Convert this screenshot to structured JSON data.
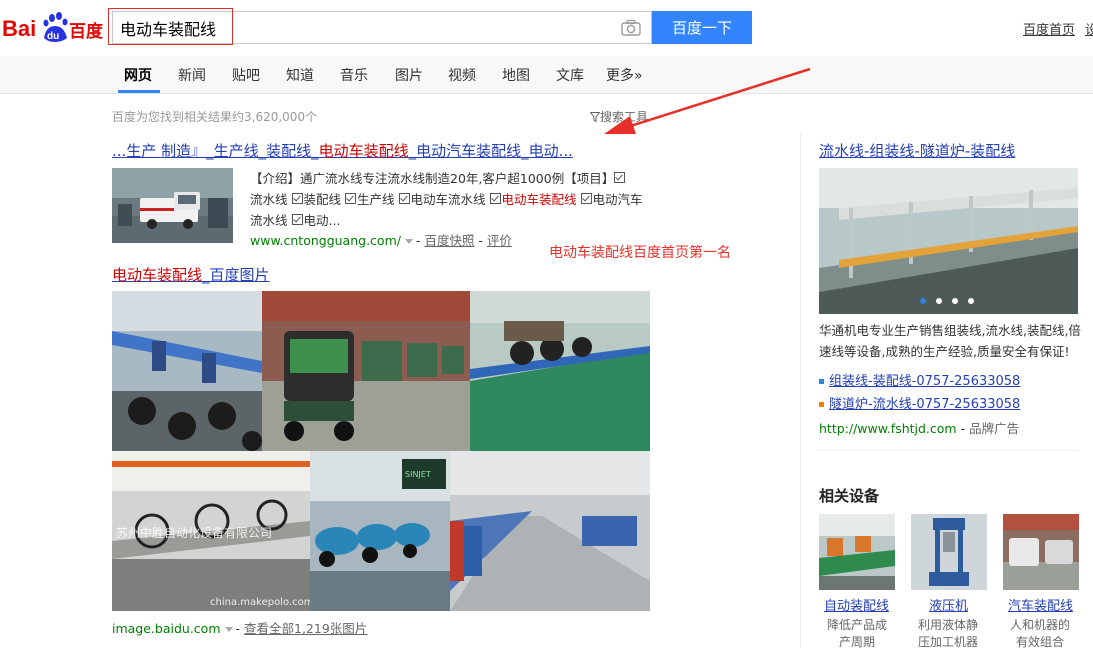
{
  "header": {
    "logo_text_left": "Bai",
    "logo_text_paw": "du",
    "logo_text_right": "百度",
    "search_value": "电动车装配线",
    "search_button": "百度一下",
    "home_link": "百度首页",
    "cut_link": "设"
  },
  "tabs": [
    {
      "label": "网页",
      "active": true
    },
    {
      "label": "新闻"
    },
    {
      "label": "贴吧"
    },
    {
      "label": "知道"
    },
    {
      "label": "音乐"
    },
    {
      "label": "图片"
    },
    {
      "label": "视频"
    },
    {
      "label": "地图"
    },
    {
      "label": "文库"
    },
    {
      "label": "更多»"
    }
  ],
  "result_count": "百度为您找到相关结果约3,620,000个",
  "search_tools": "搜索工具",
  "result1": {
    "title_parts": [
      "...生产 制造』_生产线_装配线_",
      "电动车装配线",
      "_电动汽车装配线_电动..."
    ],
    "snippet_line1": "【介绍】通广流水线专注流水线制造20年,客户超1000例【项目】",
    "snippet_items": [
      "流水线",
      "装配线",
      "生产线",
      "电动车流水线",
      "电动车装配线",
      "电动汽车流水线",
      "电动..."
    ],
    "url": "www.cntongguang.com/",
    "cache": "百度快照",
    "review": "评价"
  },
  "annotation": "电动车装配线百度首页第一名",
  "images": {
    "title_hl": "电动车装配线",
    "title_rest": "_百度图片",
    "watermark1": "苏州中胜自动化设备有限公司",
    "watermark2": "china.makepolo.com",
    "sign_text": "SINJET",
    "url": "image.baidu.com",
    "view_all": "查看全部1,219张图片"
  },
  "ad": {
    "title": "流水线-组装线-隧道炉-装配线",
    "desc": "华通机电专业生产销售组装线,流水线,装配线,倍速线等设备,成熟的生产经验,质量安全有保证!",
    "links": [
      {
        "text": "组装线-装配线-0757-25633058",
        "color": "#2b83dc"
      },
      {
        "text": "隧道炉-流水线-0757-25633058",
        "color": "#f08200"
      }
    ],
    "url": "http://www.fshtjd.com",
    "brand": "品牌广告"
  },
  "related": {
    "heading": "相关设备",
    "items": [
      {
        "name": "自动装配线",
        "desc1": "降低产品成",
        "desc2": "产周期"
      },
      {
        "name": "液压机",
        "desc1": "利用液体静",
        "desc2": "压加工机器"
      },
      {
        "name": "汽车装配线",
        "desc1": "人和机器的",
        "desc2": "有效组合"
      }
    ]
  },
  "colors": {
    "link": "#2440b3",
    "highlight": "#cc0000",
    "url_green": "#008000",
    "button_blue": "#3385ff",
    "annotation_red": "#e7302a"
  }
}
